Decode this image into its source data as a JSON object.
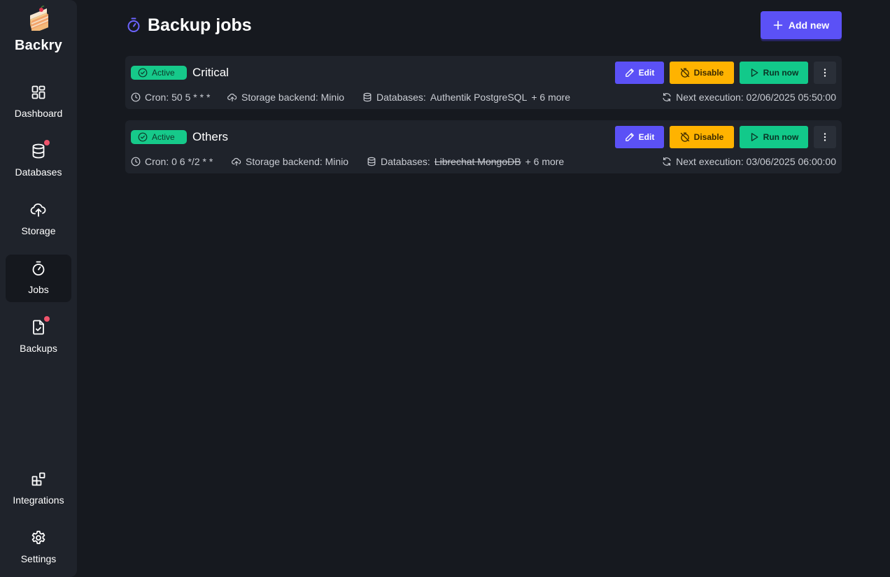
{
  "app": {
    "name": "Backry",
    "logo_icon": "cake-slice-icon"
  },
  "sidebar": {
    "items": [
      {
        "label": "Dashboard",
        "icon": "dashboard-grid-icon",
        "active": false,
        "notification": false
      },
      {
        "label": "Databases",
        "icon": "database-icon",
        "active": false,
        "notification": true
      },
      {
        "label": "Storage",
        "icon": "cloud-upload-icon",
        "active": false,
        "notification": false
      },
      {
        "label": "Jobs",
        "icon": "stopwatch-icon",
        "active": true,
        "notification": false
      },
      {
        "label": "Backups",
        "icon": "file-check-icon",
        "active": false,
        "notification": true
      }
    ],
    "bottom_items": [
      {
        "label": "Integrations",
        "icon": "integrations-icon"
      },
      {
        "label": "Settings",
        "icon": "gear-icon"
      }
    ]
  },
  "header": {
    "title": "Backup jobs",
    "title_icon": "stopwatch-icon",
    "add_button_label": "Add new"
  },
  "jobs": [
    {
      "status": "Active",
      "name": "Critical",
      "cron": "Cron: 50 5 * * *",
      "storage": "Storage backend: Minio",
      "databases_prefix": "Databases:",
      "databases_first": "Authentik PostgreSQL",
      "databases_first_disabled": false,
      "databases_more": "+ 6 more",
      "next_execution": "Next execution: 02/06/2025 05:50:00",
      "edit_label": "Edit",
      "disable_label": "Disable",
      "run_label": "Run now"
    },
    {
      "status": "Active",
      "name": "Others",
      "cron": "Cron: 0 6 */2 * *",
      "storage": "Storage backend: Minio",
      "databases_prefix": "Databases:",
      "databases_first": "Librechat MongoDB",
      "databases_first_disabled": true,
      "databases_more": "+ 6 more",
      "next_execution": "Next execution: 03/06/2025 06:00:00",
      "edit_label": "Edit",
      "disable_label": "Disable",
      "run_label": "Run now"
    }
  ],
  "colors": {
    "background": "#16191f",
    "sidebar": "#1f232b",
    "primary": "#5b51f6",
    "active_badge": "#16c98a",
    "warning": "#ffb300",
    "success": "#12c98a",
    "notification_dot": "#f0546c"
  }
}
